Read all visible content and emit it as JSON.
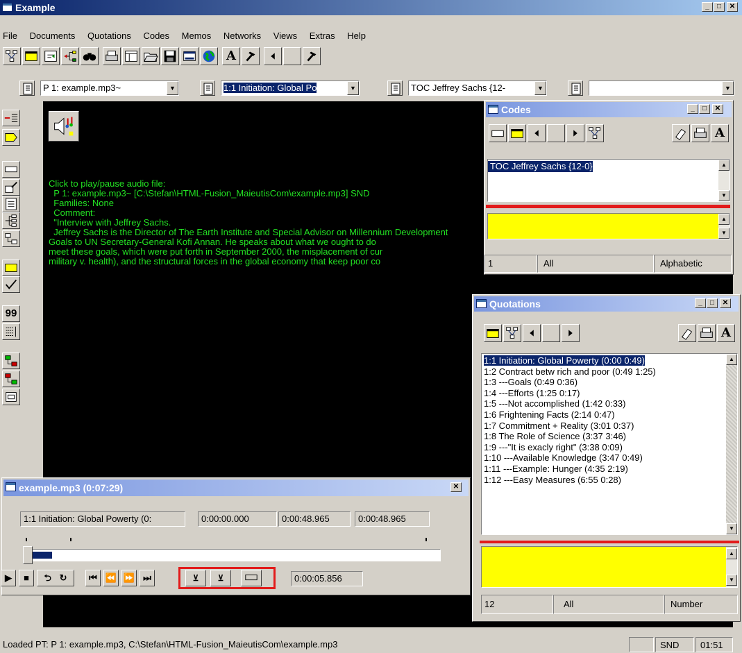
{
  "window": {
    "title": "Example"
  },
  "menu": [
    "File",
    "Documents",
    "Quotations",
    "Codes",
    "Memos",
    "Networks",
    "Views",
    "Extras",
    "Help"
  ],
  "toolbar": {
    "icons": [
      "network-icon",
      "window-icon",
      "export-icon",
      "tree-icon",
      "binoculars-icon",
      "print-icon",
      "layout-icon",
      "open-folder-icon",
      "save-icon",
      "window-list-icon",
      "globe-icon",
      "font-icon",
      "hammer-icon",
      "arrow-left-icon",
      "hammer-icon"
    ]
  },
  "selectors": {
    "document": "P 1: example.mp3~",
    "quotation": "1:1 Initiation: Global Po",
    "code": "TOC Jeffrey Sachs {12-",
    "memo": ""
  },
  "document": {
    "lines": [
      "Click to play/pause audio file:",
      "",
      "  P 1: example.mp3~ [C:\\Stefan\\HTML-Fusion_MaieutisCom\\example.mp3] SND",
      "  Families: None",
      "",
      "  Comment:",
      "  \"Interview with Jeffrey Sachs.",
      "  Jeffrey Sachs is the Director of The Earth Institute and Special Advisor on Millennium Development",
      "Goals to UN Secretary-General Kofi Annan. He speaks about what we ought to do",
      "meet these goals, which were put forth in September 2000, the misplacement of cur",
      "military v. health), and the structural forces in the global economy that keep poor co"
    ]
  },
  "codes_window": {
    "title": "Codes",
    "items": [
      "TOC Jeffrey Sachs {12-0}"
    ],
    "status": {
      "count": "1",
      "filter": "All",
      "sort": "Alphabetic"
    }
  },
  "quotations_window": {
    "title": "Quotations",
    "items": [
      "1:1 Initiation: Global Powerty (0:00 0:49)",
      "1:2 Contract betw rich and poor (0:49 1:25)",
      "1:3 ---Goals (0:49 0:36)",
      "1:4 ---Efforts (1:25 0:17)",
      "1:5 ---Not accomplished (1:42 0:33)",
      "1:6 Frightening Facts (2:14 0:47)",
      "1:7 Commitment + Reality (3:01 0:37)",
      "1:8 The Role of Science (3:37 3:46)",
      "1:9 ---\"It is exacly right\" (3:38 0:09)",
      "1:10 ---Available Knowledge (3:47 0:49)",
      "1:11 ---Example: Hunger (4:35 2:19)",
      "1:12 ---Easy Measures (6:55 0:28)"
    ],
    "status": {
      "count": "12",
      "filter": "All",
      "sort": "Number"
    }
  },
  "player": {
    "title": "example.mp3 (0:07:29)",
    "quotation": "1:1 Initiation: Global Powerty (0:",
    "start": "0:00:00.000",
    "end": "0:00:48.965",
    "duration": "0:00:48.965",
    "position": "0:00:05.856",
    "progress": 0.063
  },
  "statusbar": {
    "message": "Loaded PT: P 1: example.mp3, C:\\Stefan\\HTML-Fusion_MaieutisCom\\example.mp3",
    "media": "SND",
    "time": "01:51"
  },
  "colors": {
    "accent": "#0a246a",
    "text_green": "#23e123",
    "highlight_red": "#e21b1b",
    "memo_yellow": "#ffff00"
  }
}
